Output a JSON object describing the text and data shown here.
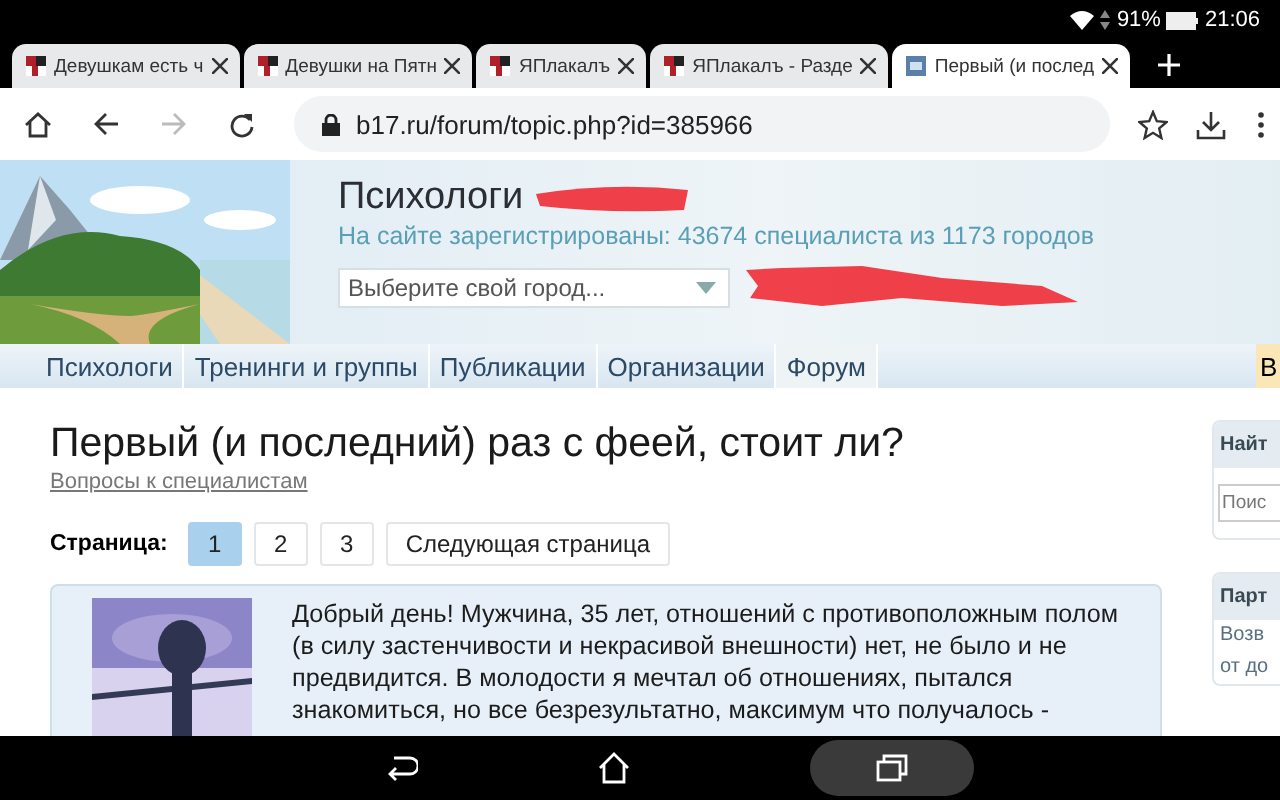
{
  "status_bar": {
    "battery": "91%",
    "time": "21:06"
  },
  "tabs": [
    {
      "label": "Девушкам есть ч",
      "selected": false
    },
    {
      "label": "Девушки на Пятн",
      "selected": false
    },
    {
      "label": "ЯПлакалъ",
      "selected": false
    },
    {
      "label": "ЯПлакалъ - Разде",
      "selected": false
    },
    {
      "label": "Первый (и послед",
      "selected": true
    }
  ],
  "address_bar": {
    "url": "b17.ru/forum/topic.php?id=385966"
  },
  "header": {
    "site_title": "Психологи",
    "stats": "На сайте зарегистрированы: 43674 специалиста из 1173 городов",
    "city_select": {
      "placeholder": "Выберите свой город..."
    }
  },
  "nav": [
    {
      "label": "Психологи",
      "selected": false
    },
    {
      "label": "Тренинги и группы",
      "selected": false
    },
    {
      "label": "Публикации",
      "selected": false
    },
    {
      "label": "Организации",
      "selected": false
    },
    {
      "label": "Форум",
      "selected": true
    }
  ],
  "nav_extra": "В",
  "topic": {
    "title": "Первый (и последний) раз с феей, стоит ли?",
    "category": "Вопросы к специалистам"
  },
  "pagination": {
    "label": "Страница:",
    "pages": [
      {
        "label": "1",
        "selected": true
      },
      {
        "label": "2",
        "selected": false
      },
      {
        "label": "3",
        "selected": false
      }
    ],
    "next": "Следующая страница"
  },
  "post": {
    "text": "Добрый день! Мужчина, 35 лет, отношений с противоположным полом (в силу застенчивости и некрасивой внешности) нет, не было и не предвидится. В молодости я мечтал об отношениях, пытался знакомиться, но все безрезультатно, максимум что получалось -"
  },
  "sidebar": [
    {
      "heading": "Найт",
      "placeholder": "Поис"
    },
    {
      "heading": "Парт",
      "lines": [
        "Возв",
        "от до"
      ]
    }
  ]
}
